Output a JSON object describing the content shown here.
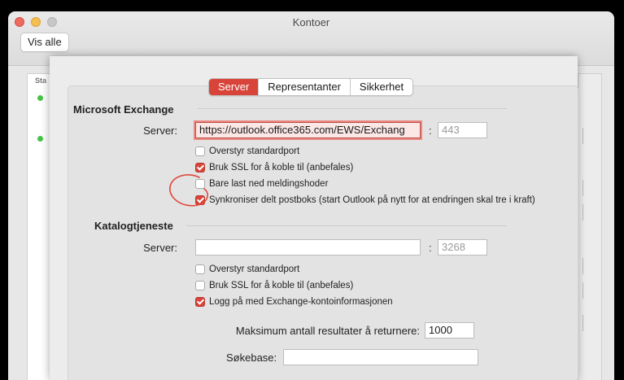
{
  "window": {
    "title": "Kontoer",
    "show_all": "Vis alle"
  },
  "background_list": {
    "column_header": "Sta"
  },
  "tabs": [
    {
      "label": "Server",
      "active": true
    },
    {
      "label": "Representanter",
      "active": false
    },
    {
      "label": "Sikkerhet",
      "active": false
    }
  ],
  "exchange": {
    "title": "Microsoft Exchange",
    "server_label": "Server:",
    "server_value": "https://outlook.office365.com/EWS/Exchang",
    "port_placeholder": "443",
    "options": [
      {
        "label": "Overstyr standardport",
        "checked": false
      },
      {
        "label": "Bruk SSL for å koble til (anbefales)",
        "checked": true
      },
      {
        "label": "Bare last ned meldingshoder",
        "checked": false
      },
      {
        "label": "Synkroniser delt postboks (start Outlook på nytt for at endringen skal tre i kraft)",
        "checked": true
      }
    ]
  },
  "directory": {
    "title": "Katalogtjeneste",
    "server_label": "Server:",
    "server_value": "",
    "port_placeholder": "3268",
    "options": [
      {
        "label": "Overstyr standardport",
        "checked": false
      },
      {
        "label": "Bruk SSL for å koble til (anbefales)",
        "checked": false
      },
      {
        "label": "Logg på med Exchange-kontoinformasjonen",
        "checked": true
      }
    ],
    "max_results_label": "Maksimum antall resultater å returnere:",
    "max_results_value": "1000",
    "searchbase_label": "Søkebase:",
    "searchbase_value": ""
  },
  "colors": {
    "accent": "#d8443a",
    "annotation": "#e0463a"
  }
}
